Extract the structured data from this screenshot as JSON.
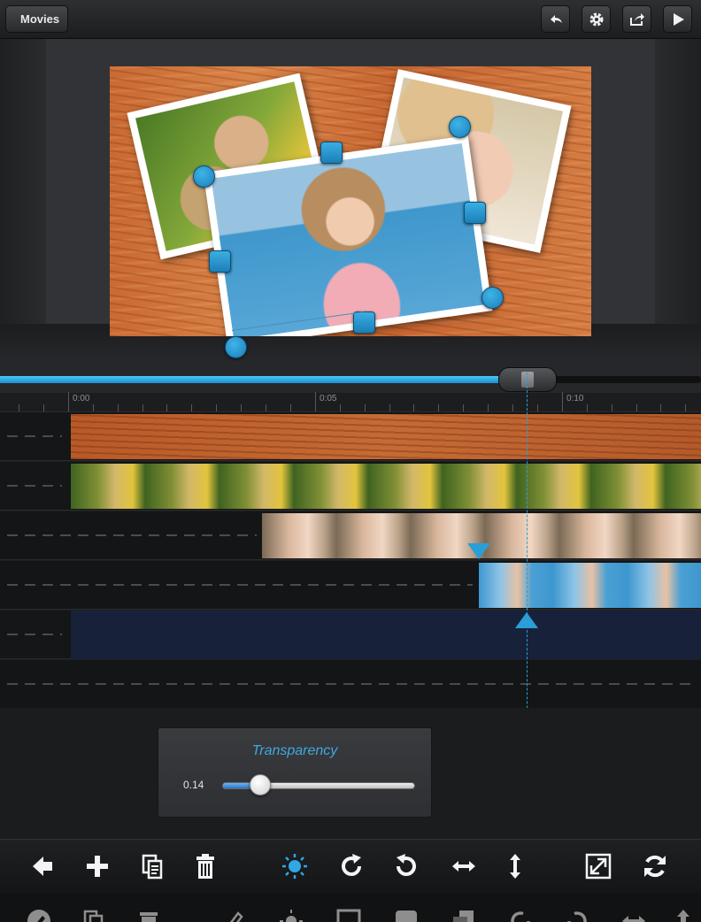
{
  "app": {
    "back_label": "Movies"
  },
  "header": {
    "buttons": [
      "undo-icon",
      "gear-icon",
      "share-icon",
      "play-icon"
    ]
  },
  "ruler": {
    "labels": [
      "0:00",
      "0:05",
      "0:10"
    ]
  },
  "scrubber": {
    "progress": 0.75
  },
  "tracks": [
    {
      "name": "background-wood",
      "start_sec": 0.0
    },
    {
      "name": "teddy-photo",
      "start_sec": 0.0
    },
    {
      "name": "girl-photo",
      "start_sec": 3.9
    },
    {
      "name": "beach-photo",
      "start_sec": 8.4
    },
    {
      "name": "empty-track",
      "start_sec": 0.0
    }
  ],
  "transparency": {
    "title": "Transparency",
    "value_label": "0.14",
    "value": 0.14
  },
  "toolbar": {
    "icons": [
      "arrow-left-icon",
      "plus-icon",
      "duplicate-icon",
      "trash-icon",
      "brightness-icon",
      "rotate-cw-icon",
      "rotate-ccw-icon",
      "flip-horizontal-icon",
      "flip-vertical-icon",
      "fullscreen-icon",
      "refresh-icon"
    ]
  },
  "toolbar2": {
    "icons": [
      "pencil-icon",
      "copy-icon",
      "trash-icon",
      "brush-icon",
      "sun-icon",
      "square-outline-icon",
      "square-filled-icon",
      "layers-icon",
      "redo-icon",
      "undo-icon",
      "swap-icon",
      "upload-icon"
    ]
  },
  "colors": {
    "accent": "#2a9ed6",
    "background": "#1d1e20"
  }
}
